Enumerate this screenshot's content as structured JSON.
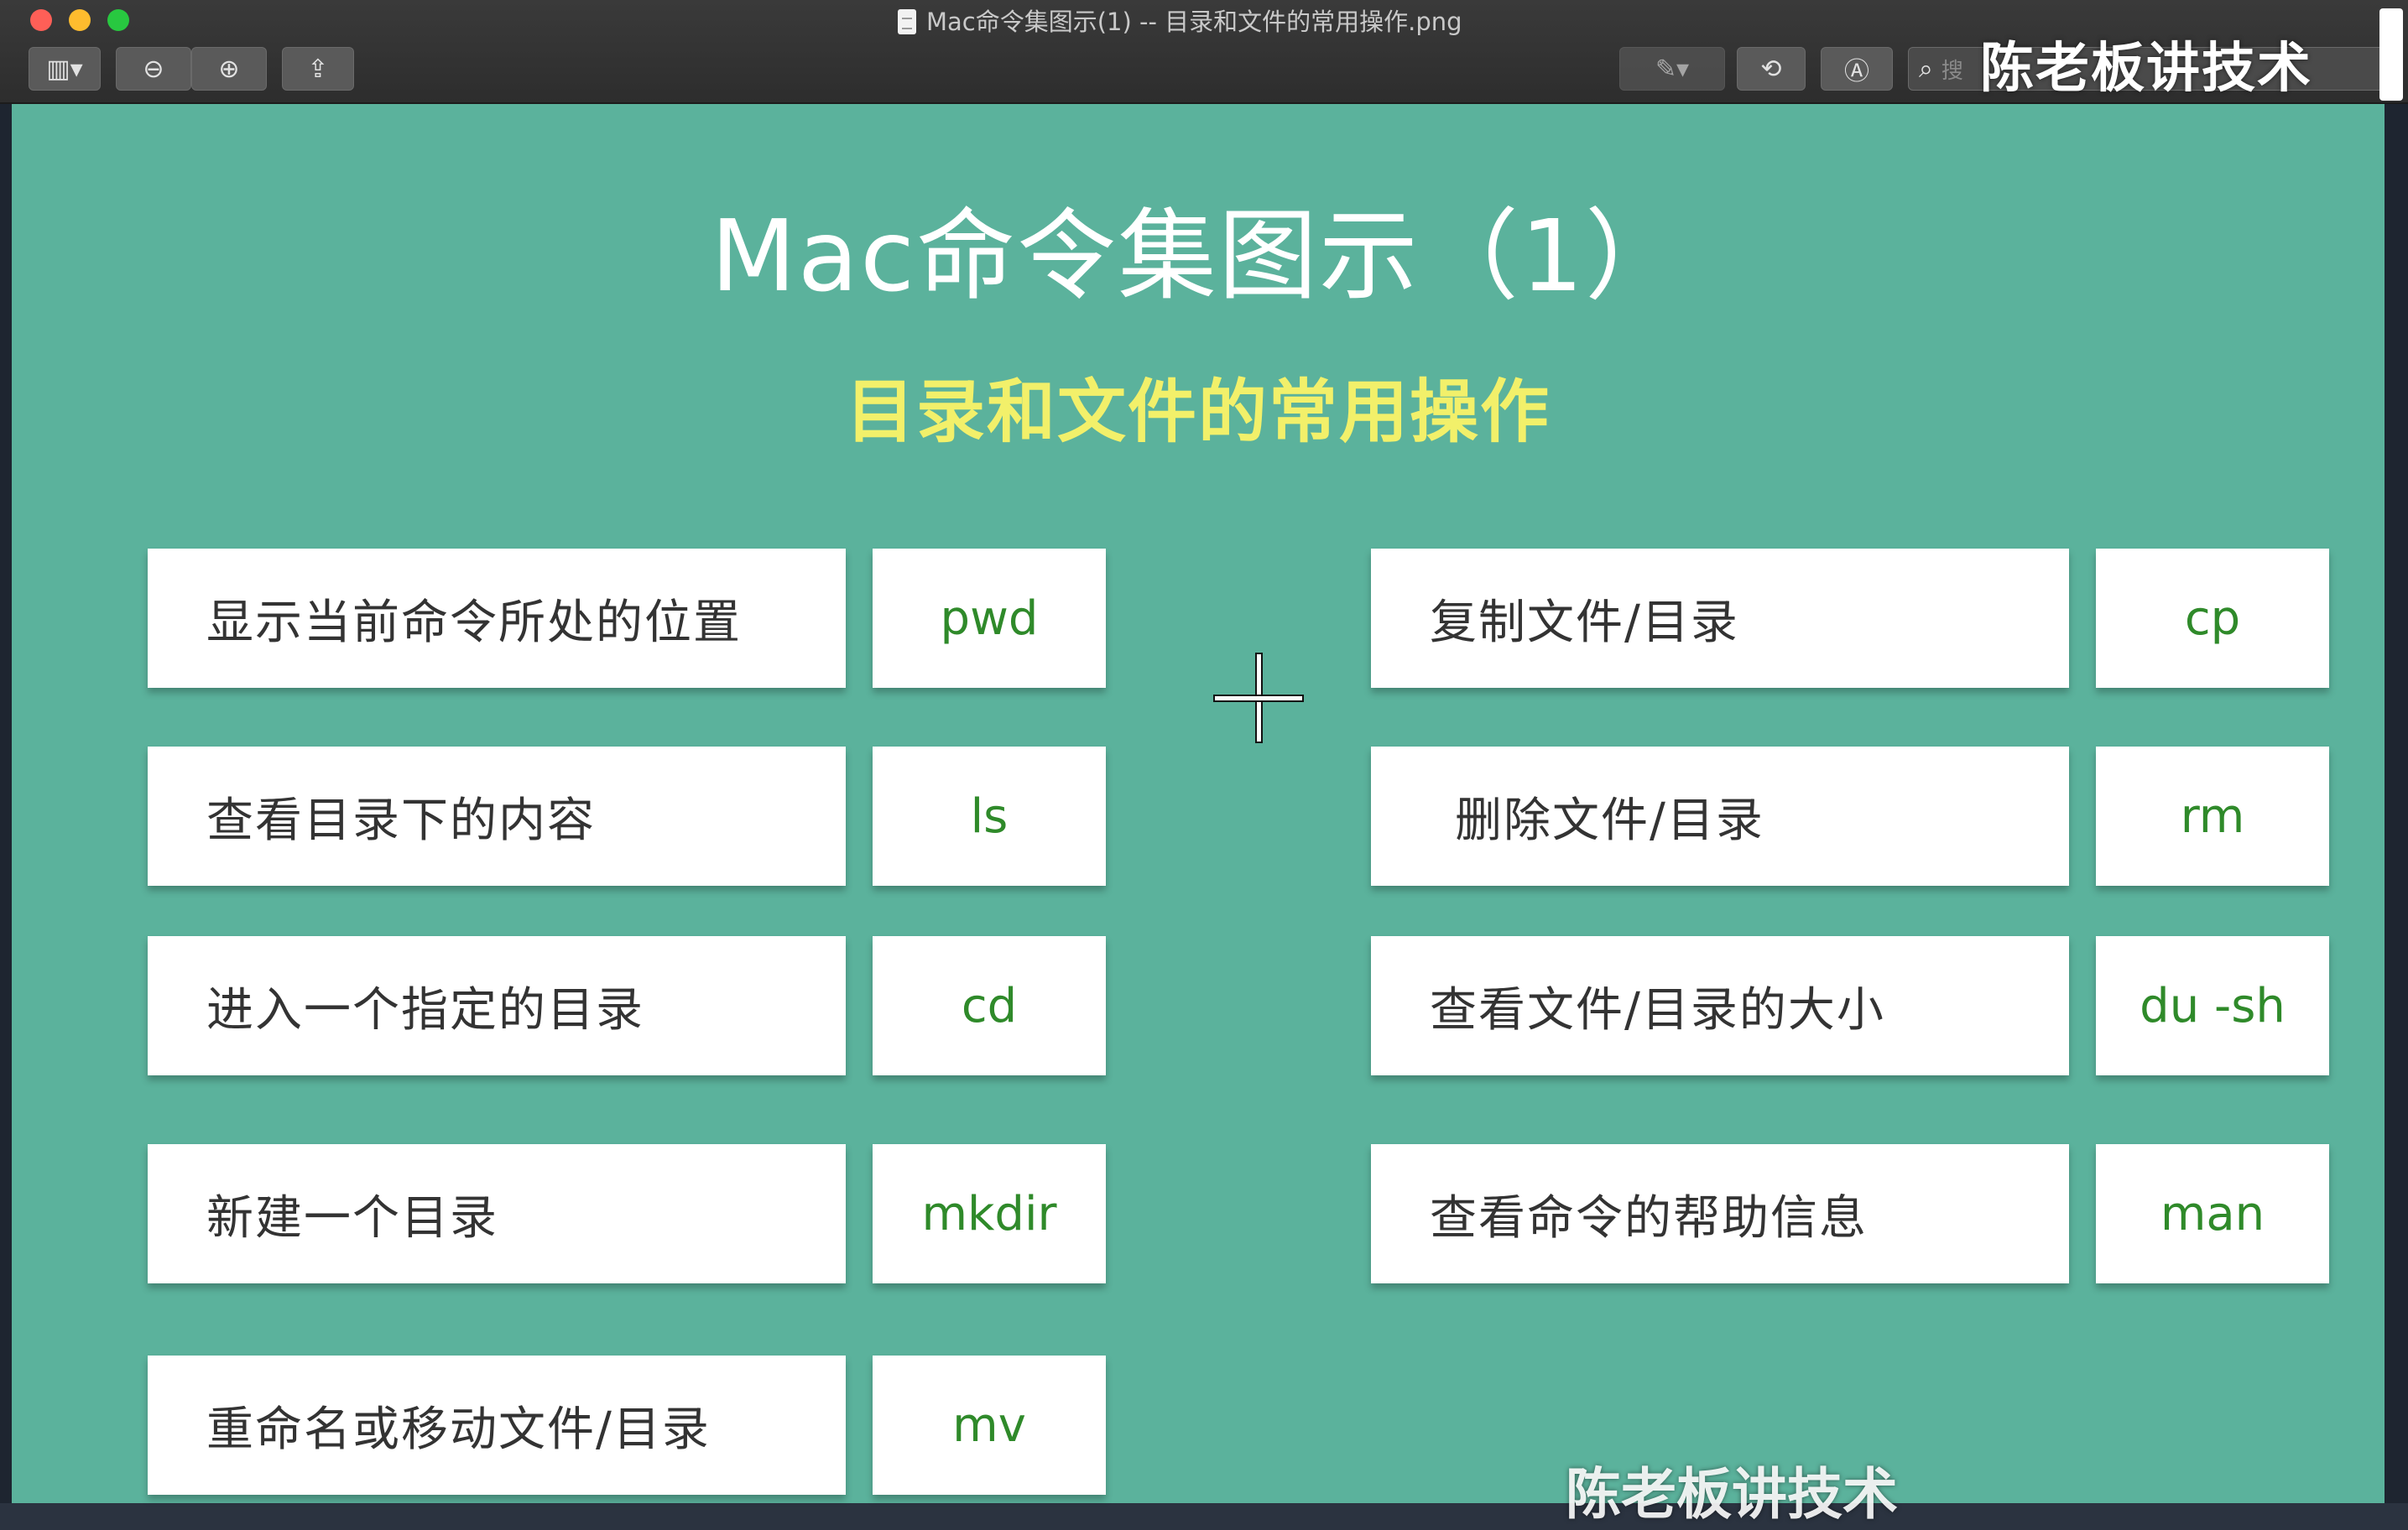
{
  "window": {
    "title": "Mac命令集图示(1) -- 目录和文件的常用操作.png",
    "search_placeholder": "搜",
    "watermark_top": "陈老板讲技术"
  },
  "toolbar": {
    "sidebar_glyph": "▥▾",
    "zoom_out_glyph": "⊖",
    "zoom_in_glyph": "⊕",
    "share_glyph": "⇪",
    "markup_glyph": "✎▾",
    "rotate_glyph": "⟲",
    "annotate_glyph": "Ⓐ",
    "search_glyph": "⌕"
  },
  "slide": {
    "title": "Mac命令集图示（1）",
    "subtitle": "目录和文件的常用操作",
    "left_commands": [
      {
        "desc": "显示当前命令所处的位置",
        "cmd": "pwd"
      },
      {
        "desc": "查看目录下的内容",
        "cmd": "ls"
      },
      {
        "desc": "进入一个指定的目录",
        "cmd": "cd"
      },
      {
        "desc": "新建一个目录",
        "cmd": "mkdir"
      },
      {
        "desc": "重命名或移动文件/目录",
        "cmd": "mv"
      }
    ],
    "right_commands": [
      {
        "desc": "复制文件/目录",
        "cmd": "cp"
      },
      {
        "desc": "删除文件/目录",
        "cmd": "rm"
      },
      {
        "desc": "查看文件/目录的大小",
        "cmd": "du -sh"
      },
      {
        "desc": "查看命令的帮助信息",
        "cmd": "man"
      }
    ],
    "watermark_bottom": "陈老板讲技术"
  },
  "colors": {
    "slide_bg": "#5bb29c",
    "subtitle": "#f2f06a",
    "command_text": "#2f8a2a"
  }
}
